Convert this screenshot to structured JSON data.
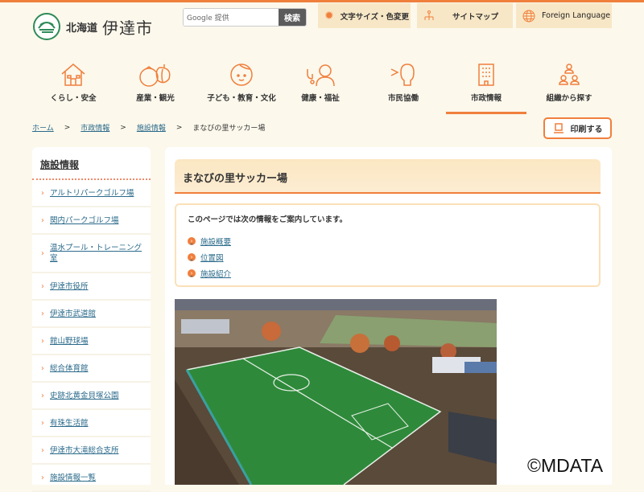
{
  "header": {
    "logo_prefix": "北海道",
    "logo_city": "伊達市",
    "search_placeholder": "Google 提供",
    "search_button": "検索",
    "tools": [
      {
        "label": "文字サイズ・色変更",
        "icon": "gear-icon"
      },
      {
        "label": "サイトマップ",
        "icon": "sitemap-icon"
      },
      {
        "label": "Foreign Language",
        "icon": "globe-icon"
      }
    ]
  },
  "nav": [
    {
      "label": "くらし・安全"
    },
    {
      "label": "産業・観光"
    },
    {
      "label": "子ども・教育・文化"
    },
    {
      "label": "健康・福祉"
    },
    {
      "label": "市民協働"
    },
    {
      "label": "市政情報",
      "active": true
    },
    {
      "label": "組織から探す"
    }
  ],
  "breadcrumb": {
    "items": [
      "ホーム",
      "市政情報",
      "施設情報"
    ],
    "current": "まなびの里サッカー場",
    "sep": ">"
  },
  "print_label": "印刷する",
  "sidebar": {
    "title": "施設情報",
    "items": [
      "アルトリパークゴルフ場",
      "関内パークゴルフ場",
      "温水プール・トレーニング室",
      "伊達市役所",
      "伊達市武道館",
      "館山野球場",
      "総合体育館",
      "史跡北黄金貝塚公園",
      "有珠生活館",
      "伊達市大滝総合支所",
      "施設情報一覧"
    ]
  },
  "main": {
    "title": "まなびの里サッカー場",
    "toc_intro": "このページでは次の情報をご案内しています。",
    "toc": [
      "施設概要",
      "位置図",
      "施設紹介"
    ]
  },
  "watermark": "©MDATA",
  "colors": {
    "accent": "#f07f3c",
    "bg": "#fcf8ec",
    "link": "#2a6a8a"
  }
}
